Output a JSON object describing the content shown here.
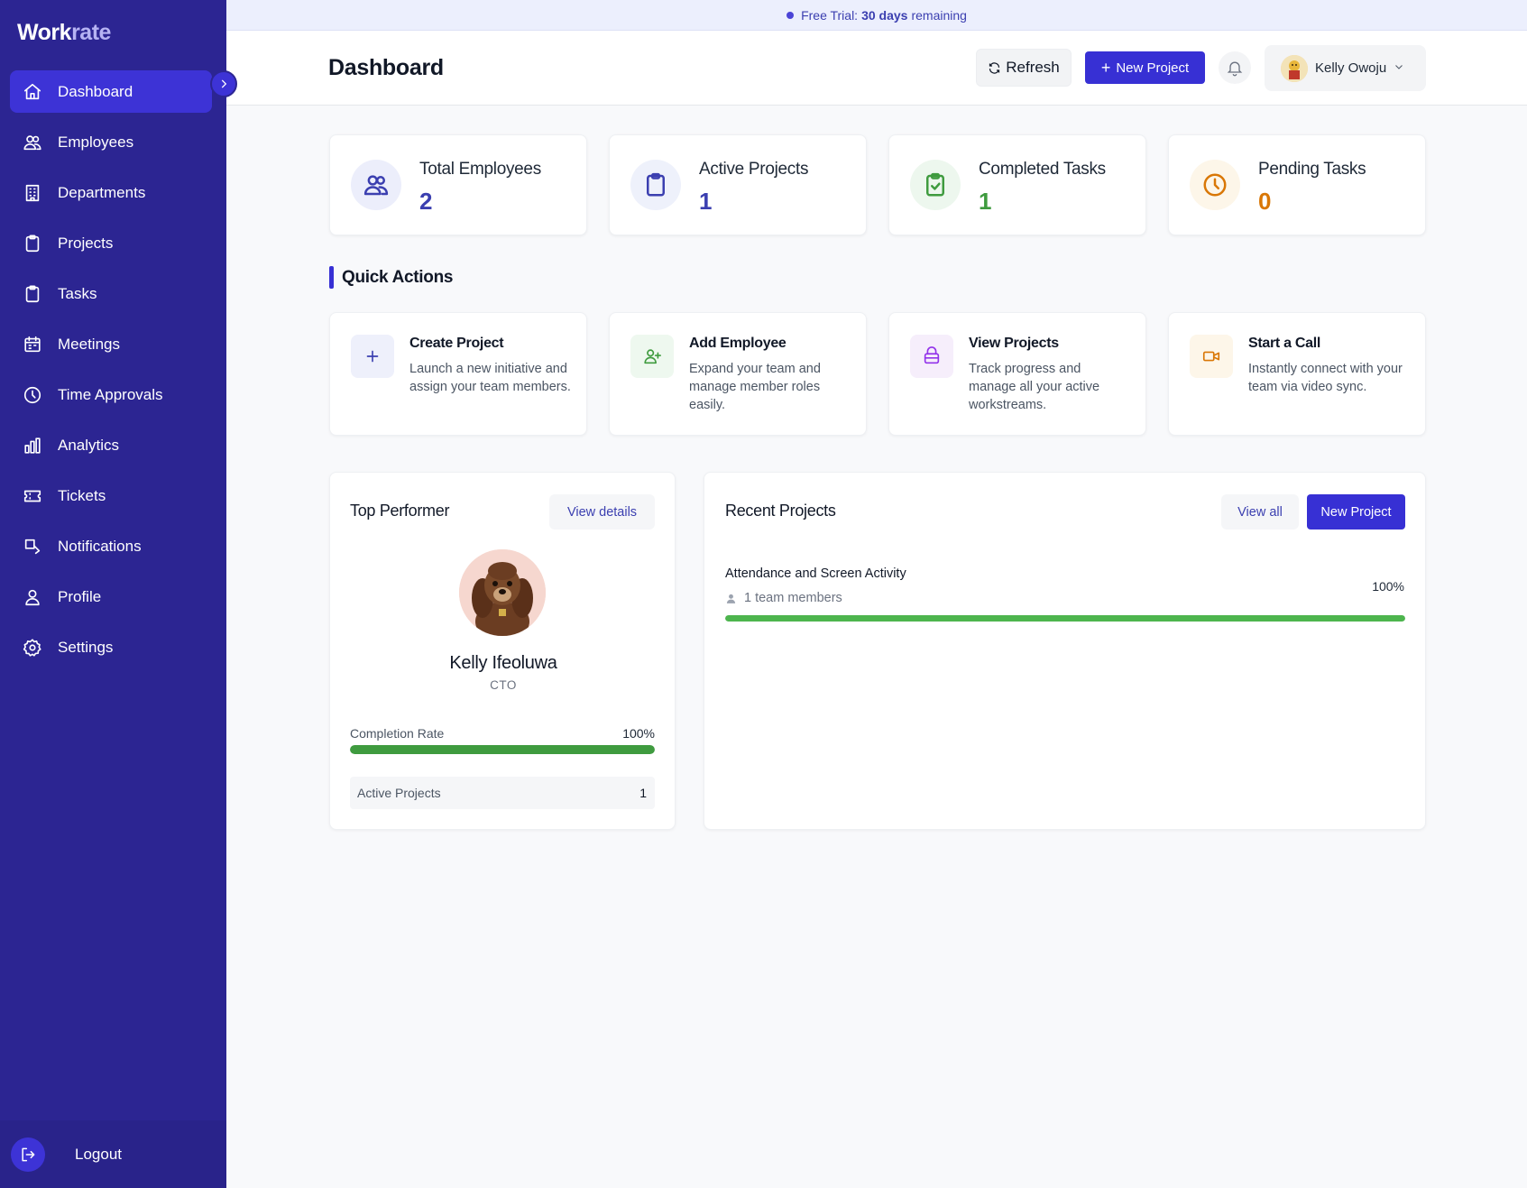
{
  "app": {
    "brand_part1": "Work",
    "brand_part2": "rate"
  },
  "trial": {
    "prefix": "Free Trial:",
    "days": "30 days",
    "suffix": "remaining"
  },
  "sidebar": {
    "items": [
      {
        "label": "Dashboard",
        "icon": "home-icon",
        "active": true
      },
      {
        "label": "Employees",
        "icon": "users-icon"
      },
      {
        "label": "Departments",
        "icon": "building-icon"
      },
      {
        "label": "Projects",
        "icon": "clipboard-icon"
      },
      {
        "label": "Tasks",
        "icon": "clipboard-icon"
      },
      {
        "label": "Meetings",
        "icon": "calendar-icon"
      },
      {
        "label": "Time Approvals",
        "icon": "clock-icon"
      },
      {
        "label": "Analytics",
        "icon": "bar-chart-icon"
      },
      {
        "label": "Tickets",
        "icon": "ticket-icon"
      },
      {
        "label": "Notifications",
        "icon": "notification-icon"
      },
      {
        "label": "Profile",
        "icon": "user-icon"
      },
      {
        "label": "Settings",
        "icon": "gear-icon"
      }
    ],
    "logout_label": "Logout"
  },
  "header": {
    "title": "Dashboard",
    "refresh_label": "Refresh",
    "new_project_label": "New Project",
    "user_name": "Kelly Owoju"
  },
  "stats": [
    {
      "title": "Total Employees",
      "value": "2",
      "color": "#3b3fb0"
    },
    {
      "title": "Active Projects",
      "value": "1",
      "color": "#3b3fb0"
    },
    {
      "title": "Completed Tasks",
      "value": "1",
      "color": "#3f9b3f"
    },
    {
      "title": "Pending Tasks",
      "value": "0",
      "color": "#d97706"
    }
  ],
  "quick_actions": {
    "title": "Quick Actions",
    "items": [
      {
        "title": "Create Project",
        "desc": "Launch a new initiative and assign your team members."
      },
      {
        "title": "Add Employee",
        "desc": "Expand your team and manage member roles easily."
      },
      {
        "title": "View Projects",
        "desc": "Track progress and manage all your active workstreams."
      },
      {
        "title": "Start a Call",
        "desc": "Instantly connect with your team via video sync."
      }
    ]
  },
  "top_performer": {
    "title": "Top Performer",
    "view_details": "View details",
    "name": "Kelly Ifeoluwa",
    "role": "CTO",
    "completion_label": "Completion Rate",
    "completion_value": "100%",
    "completion_fraction": 1.0,
    "active_projects_label": "Active Projects",
    "active_projects_value": "1"
  },
  "recent_projects": {
    "title": "Recent Projects",
    "view_all": "View all",
    "new_project": "New Project",
    "projects": [
      {
        "name": "Attendance and Screen Activity",
        "members": "1 team members",
        "progress": "100%",
        "progress_fraction": 1.0
      }
    ]
  }
}
